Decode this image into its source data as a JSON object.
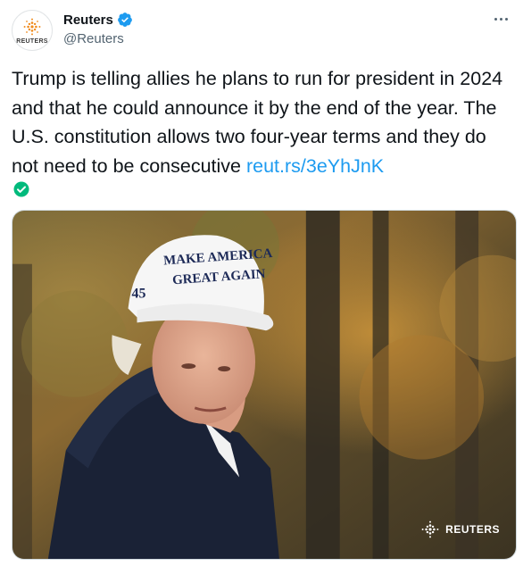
{
  "account": {
    "display_name": "Reuters",
    "handle": "@Reuters",
    "avatar_text": "REUTERS",
    "verified": true
  },
  "tweet": {
    "text": "Trump is telling allies he plans to run for president in 2024 and that he could announce it by the end of the year. The U.S. constitution allows two four-year terms and they do not need to be consecutive ",
    "link": "reut.rs/3eYhJnK"
  },
  "media": {
    "hat_line1": "MAKE AMERICA",
    "hat_line2": "GREAT AGAIN",
    "hat_number": "45",
    "watermark": "REUTERS"
  },
  "icons": {
    "verified": "verified-badge-icon",
    "more": "more-options-icon",
    "check": "check-circle-icon",
    "logo": "reuters-logo-icon"
  },
  "colors": {
    "link": "#1d9bf0",
    "verified": "#1d9bf0",
    "check": "#00ba7c",
    "text": "#0f1419",
    "secondary": "#536471"
  }
}
